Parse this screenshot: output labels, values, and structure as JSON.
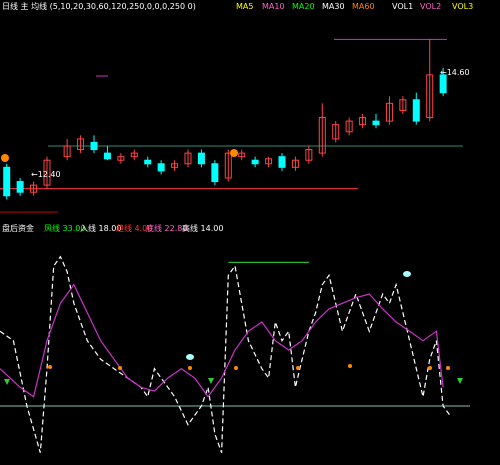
{
  "colors": {
    "background": "#000000",
    "up_candle": "#ff4444",
    "down_candle": "#00ffff",
    "white_line": "#ffffff",
    "magenta_line": "#cc33cc",
    "green_line": "#33cc33",
    "red_line": "#ff3333",
    "teal_line": "#2e8b77",
    "orange_marker": "#ff8800",
    "yellow_text": "#ffff00",
    "green_text": "#00ff00",
    "pink_text": "#ff66cc"
  },
  "top_header": {
    "title": "日线 主 均线 (5,10,20,30,60,120,250,0,0,0,250 0)",
    "ma5_label": "MA5",
    "ma10_label": "MA10",
    "ma20_label": "MA20",
    "ma30_label": "MA30",
    "ma60_label": "MA60",
    "vol1": "VOL1",
    "vol2": "VOL2",
    "vol3": "VOL3"
  },
  "price_annotations": {
    "low_label": "←12.40",
    "high_label": "←14.60"
  },
  "indicator_header": {
    "name": "盘后资金",
    "item1": "风线 33.00",
    "item2": "入线 18.00",
    "item3": "趋线 4.00",
    "item4": "底线 22.80",
    "item5": "高线 14.00"
  },
  "chart_data": [
    {
      "type": "candlestick",
      "title": "",
      "levels": [
        {
          "name": "support",
          "value": 12.5,
          "color": "red"
        },
        {
          "name": "mid",
          "value": 13.1,
          "color": "teal"
        },
        {
          "name": "resistance",
          "value": 14.6,
          "color": "magenta"
        }
      ],
      "x_range": [
        0,
        70
      ],
      "y_range": [
        12.2,
        14.9
      ],
      "candles": [
        {
          "x": 1,
          "o": 12.8,
          "c": 12.4,
          "h": 12.85,
          "l": 12.35
        },
        {
          "x": 3,
          "o": 12.6,
          "c": 12.45,
          "h": 12.65,
          "l": 12.4
        },
        {
          "x": 5,
          "o": 12.45,
          "c": 12.55,
          "h": 12.6,
          "l": 12.4
        },
        {
          "x": 7,
          "o": 12.55,
          "c": 12.9,
          "h": 12.95,
          "l": 12.5
        },
        {
          "x": 10,
          "o": 12.95,
          "c": 13.1,
          "h": 13.2,
          "l": 12.9
        },
        {
          "x": 12,
          "o": 13.05,
          "c": 13.2,
          "h": 13.25,
          "l": 13.0
        },
        {
          "x": 14,
          "o": 13.15,
          "c": 13.05,
          "h": 13.25,
          "l": 13.0
        },
        {
          "x": 16,
          "o": 13.0,
          "c": 12.92,
          "h": 13.1,
          "l": 12.9
        },
        {
          "x": 18,
          "o": 12.9,
          "c": 12.95,
          "h": 13.0,
          "l": 12.85
        },
        {
          "x": 20,
          "o": 12.95,
          "c": 13.0,
          "h": 13.05,
          "l": 12.9
        },
        {
          "x": 22,
          "o": 12.9,
          "c": 12.85,
          "h": 12.95,
          "l": 12.8
        },
        {
          "x": 24,
          "o": 12.85,
          "c": 12.75,
          "h": 12.9,
          "l": 12.7
        },
        {
          "x": 26,
          "o": 12.8,
          "c": 12.85,
          "h": 12.9,
          "l": 12.75
        },
        {
          "x": 28,
          "o": 12.85,
          "c": 13.0,
          "h": 13.05,
          "l": 12.8
        },
        {
          "x": 30,
          "o": 13.0,
          "c": 12.85,
          "h": 13.05,
          "l": 12.8
        },
        {
          "x": 32,
          "o": 12.85,
          "c": 12.6,
          "h": 12.9,
          "l": 12.55
        },
        {
          "x": 34,
          "o": 12.65,
          "c": 13.0,
          "h": 13.05,
          "l": 12.6
        },
        {
          "x": 36,
          "o": 12.95,
          "c": 13.0,
          "h": 13.05,
          "l": 12.9
        },
        {
          "x": 38,
          "o": 12.9,
          "c": 12.85,
          "h": 12.95,
          "l": 12.8
        },
        {
          "x": 40,
          "o": 12.85,
          "c": 12.92,
          "h": 12.95,
          "l": 12.8
        },
        {
          "x": 42,
          "o": 12.95,
          "c": 12.8,
          "h": 13.0,
          "l": 12.75
        },
        {
          "x": 44,
          "o": 12.8,
          "c": 12.9,
          "h": 12.95,
          "l": 12.75
        },
        {
          "x": 46,
          "o": 12.9,
          "c": 13.05,
          "h": 13.1,
          "l": 12.85
        },
        {
          "x": 48,
          "o": 13.0,
          "c": 13.5,
          "h": 13.7,
          "l": 12.95
        },
        {
          "x": 50,
          "o": 13.2,
          "c": 13.4,
          "h": 13.45,
          "l": 13.15
        },
        {
          "x": 52,
          "o": 13.3,
          "c": 13.45,
          "h": 13.5,
          "l": 13.25
        },
        {
          "x": 54,
          "o": 13.4,
          "c": 13.5,
          "h": 13.55,
          "l": 13.35
        },
        {
          "x": 56,
          "o": 13.45,
          "c": 13.4,
          "h": 13.55,
          "l": 13.35
        },
        {
          "x": 58,
          "o": 13.45,
          "c": 13.7,
          "h": 13.8,
          "l": 13.4
        },
        {
          "x": 60,
          "o": 13.6,
          "c": 13.75,
          "h": 13.8,
          "l": 13.55
        },
        {
          "x": 62,
          "o": 13.75,
          "c": 13.45,
          "h": 13.85,
          "l": 13.4
        },
        {
          "x": 64,
          "o": 13.5,
          "c": 14.1,
          "h": 14.6,
          "l": 13.45
        },
        {
          "x": 66,
          "o": 14.1,
          "c": 13.85,
          "h": 14.2,
          "l": 13.8
        }
      ]
    },
    {
      "type": "line",
      "title": "",
      "x_range": [
        0,
        70
      ],
      "y_range": [
        -10,
        110
      ],
      "baseline": 20,
      "series": [
        {
          "name": "",
          "color": "white",
          "style": "dashed",
          "points": [
            [
              0,
              60
            ],
            [
              2,
              55
            ],
            [
              4,
              20
            ],
            [
              6,
              -5
            ],
            [
              7,
              40
            ],
            [
              8,
              95
            ],
            [
              9,
              100
            ],
            [
              10,
              92
            ],
            [
              11,
              75
            ],
            [
              13,
              55
            ],
            [
              15,
              45
            ],
            [
              17,
              40
            ],
            [
              19,
              35
            ],
            [
              21,
              30
            ],
            [
              22,
              25
            ],
            [
              23,
              40
            ],
            [
              24,
              35
            ],
            [
              26,
              25
            ],
            [
              28,
              10
            ],
            [
              30,
              20
            ],
            [
              31,
              30
            ],
            [
              32,
              5
            ],
            [
              33,
              -5
            ],
            [
              34,
              90
            ],
            [
              35,
              95
            ],
            [
              37,
              55
            ],
            [
              39,
              40
            ],
            [
              40,
              35
            ],
            [
              41,
              65
            ],
            [
              42,
              55
            ],
            [
              43,
              60
            ],
            [
              44,
              30
            ],
            [
              45,
              45
            ],
            [
              46,
              60
            ],
            [
              47,
              70
            ],
            [
              48,
              85
            ],
            [
              49,
              90
            ],
            [
              50,
              75
            ],
            [
              51,
              60
            ],
            [
              52,
              70
            ],
            [
              53,
              80
            ],
            [
              54,
              70
            ],
            [
              55,
              60
            ],
            [
              56,
              70
            ],
            [
              57,
              80
            ],
            [
              58,
              75
            ],
            [
              59,
              85
            ],
            [
              60,
              70
            ],
            [
              61,
              55
            ],
            [
              62,
              40
            ],
            [
              63,
              25
            ],
            [
              64,
              45
            ],
            [
              65,
              55
            ],
            [
              66,
              20
            ],
            [
              67,
              15
            ]
          ]
        },
        {
          "name": "",
          "color": "magenta",
          "style": "solid",
          "points": [
            [
              0,
              40
            ],
            [
              3,
              30
            ],
            [
              5,
              25
            ],
            [
              7,
              55
            ],
            [
              9,
              75
            ],
            [
              11,
              85
            ],
            [
              13,
              70
            ],
            [
              15,
              55
            ],
            [
              17,
              45
            ],
            [
              19,
              35
            ],
            [
              21,
              30
            ],
            [
              23,
              28
            ],
            [
              25,
              35
            ],
            [
              27,
              40
            ],
            [
              29,
              35
            ],
            [
              31,
              25
            ],
            [
              33,
              35
            ],
            [
              35,
              50
            ],
            [
              37,
              60
            ],
            [
              39,
              65
            ],
            [
              41,
              55
            ],
            [
              43,
              50
            ],
            [
              45,
              55
            ],
            [
              47,
              65
            ],
            [
              49,
              72
            ],
            [
              51,
              75
            ],
            [
              53,
              78
            ],
            [
              55,
              80
            ],
            [
              57,
              72
            ],
            [
              59,
              65
            ],
            [
              61,
              60
            ],
            [
              63,
              55
            ],
            [
              65,
              60
            ],
            [
              66,
              30
            ]
          ]
        },
        {
          "name": "",
          "color": "green",
          "style": "solid",
          "points": [
            [
              34,
              97
            ],
            [
              46,
              97
            ]
          ]
        }
      ]
    }
  ]
}
